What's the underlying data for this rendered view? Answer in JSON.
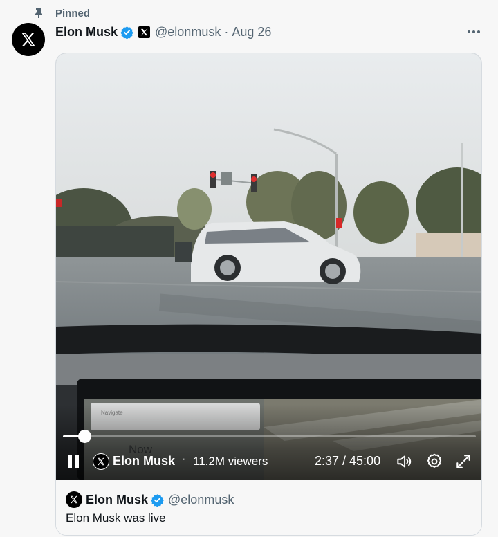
{
  "pinned": {
    "label": "Pinned",
    "icon": "pin-icon"
  },
  "post": {
    "author_name": "Elon Musk",
    "author_handle": "@elonmusk",
    "separator": "·",
    "date": "Aug 26",
    "avatar_icon": "x-logo-icon",
    "verified_icon": "verified-badge-icon",
    "affiliation_icon": "x-affiliation-badge-icon",
    "more_icon": "more-options-icon"
  },
  "video": {
    "progress": 0.0525,
    "live_host": "Elon Musk",
    "dot": "·",
    "viewers": "11.2M viewers",
    "time": "2:37 / 45:00",
    "icons": [
      "pause-icon",
      "volume-icon",
      "settings-icon",
      "fullscreen-icon"
    ]
  },
  "quote": {
    "author_name": "Elon Musk",
    "author_handle": "@elonmusk",
    "text": "Elon Musk was live"
  },
  "colors": {
    "verified": "#1d9bf0",
    "secondary_text": "#536471",
    "primary_text": "#0f1419"
  }
}
